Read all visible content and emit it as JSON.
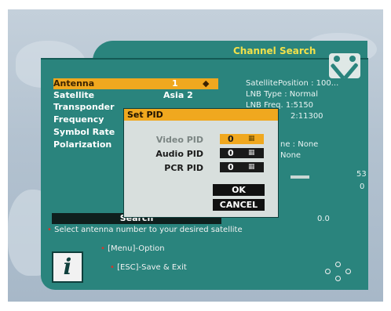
{
  "header": {
    "title": "Channel Search",
    "tools_icon": "tools-icon"
  },
  "settings": [
    {
      "label": "Antenna",
      "value": "1"
    },
    {
      "label": "Satellite",
      "value": "Asia 2"
    },
    {
      "label": "Transponder",
      "value": ""
    },
    {
      "label": "Frequency",
      "value": ""
    },
    {
      "label": "Symbol Rate",
      "value": ""
    },
    {
      "label": "Polarization",
      "value": ""
    }
  ],
  "antenna_arrows": "◆",
  "info": {
    "satellite_position": "SatellitePosition : 100...",
    "lnb_type": "LNB Type : Normal",
    "lnb_freq": "LNB Freq. 1:5150",
    "lnb_freq2": "2:11300",
    "line5": "ne : None",
    "line6": "None"
  },
  "signal": {
    "value1": "53",
    "value2": "0"
  },
  "search_button": "Search",
  "bottom_value": "0.0",
  "dialog": {
    "title": "Set PID",
    "video_pid_label": "Video PID",
    "video_pid_value": "0",
    "audio_pid_label": "Audio PID",
    "audio_pid_value": "0",
    "pcr_pid_label": "PCR PID",
    "pcr_pid_value": "0",
    "grid_glyph": "▦",
    "ok_label": "OK",
    "cancel_label": "CANCEL"
  },
  "help": {
    "text": "Select antenna number to your desired satellite",
    "menu_hint": "[Menu]-Option",
    "esc_hint": "[ESC]-Save & Exit",
    "info_glyph": "i"
  },
  "colors": {
    "panel": "#2a847d",
    "accent": "#f0a81f",
    "title": "#f2e04a"
  }
}
